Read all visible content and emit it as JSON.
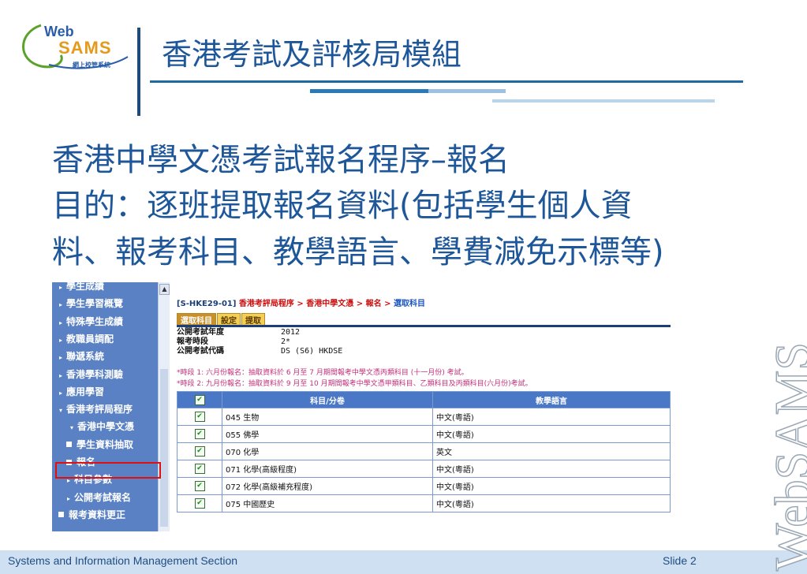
{
  "header": {
    "logo_web": "Web",
    "logo_sams": "SAMS",
    "logo_subtitle": "網上校管系統",
    "title": "香港考試及評核局模組"
  },
  "headings": {
    "line1": "香港中學文憑考試報名程序–報名",
    "line2": "目的：逐班提取報名資料(包括學生個人資",
    "line3": "料、報考科目、教學語言、學費減免示標等)"
  },
  "screenshot": {
    "sidebar": {
      "items": [
        {
          "label": "學生成績",
          "marker": "arrow"
        },
        {
          "label": "學生學習概覽",
          "marker": "arrow"
        },
        {
          "label": "特殊學生成績",
          "marker": "arrow"
        },
        {
          "label": "教職員調配",
          "marker": "arrow"
        },
        {
          "label": "聯遞系統",
          "marker": "arrow"
        },
        {
          "label": "香港學科測驗",
          "marker": "arrow"
        },
        {
          "label": "應用學習",
          "marker": "arrow"
        },
        {
          "label": "香港考評局程序",
          "marker": "expanded"
        },
        {
          "label": "香港中學文憑",
          "marker": "expanded"
        },
        {
          "label": "學生資料抽取",
          "marker": "bullet"
        },
        {
          "label": "報名",
          "marker": "bullet"
        },
        {
          "label": "科目參數",
          "marker": "arrow"
        },
        {
          "label": "公開考試報名",
          "marker": "arrow"
        },
        {
          "label": "報考資料更正",
          "marker": "bullet"
        }
      ],
      "scroll_up_icon": "▲"
    },
    "breadcrumb": {
      "code": "[S-HKE29-01]",
      "path": "香港考評局程序 > 香港中學文憑 > 報名 >",
      "current": "選取科目"
    },
    "tabs": [
      "選取科目",
      "設定",
      "提取"
    ],
    "info": [
      {
        "label": "公開考試年度",
        "value": "2012"
      },
      {
        "label": "報考時段",
        "value": "2*"
      },
      {
        "label": "公開考試代碼",
        "value": "DS (S6) HKDSE"
      }
    ],
    "notes": [
      "*時段 1: 六月份報名：抽取資料於 6 月至 7 月期間報考中學文憑丙類科目 (十一月份) 考試。",
      "*時段 2: 九月份報名：抽取資料於 9 月至 10 月期間報考中學文憑甲類科目、乙類科目及丙類科目(六月份)考試。"
    ],
    "table": {
      "headers": [
        "☑",
        "科目/分卷",
        "教學語言"
      ],
      "rows": [
        {
          "checked": "✔",
          "subject": "045 生物",
          "language": "中文(粵語)"
        },
        {
          "checked": "✔",
          "subject": "055 佛學",
          "language": "中文(粵語)"
        },
        {
          "checked": "✔",
          "subject": "070 化學",
          "language": "英文"
        },
        {
          "checked": "✔",
          "subject": "071 化學(高級程度)",
          "language": "中文(粵語)"
        },
        {
          "checked": "✔",
          "subject": "072 化學(高級補充程度)",
          "language": "中文(粵語)"
        },
        {
          "checked": "✔",
          "subject": "075 中國歷史",
          "language": "中文(粵語)"
        }
      ]
    }
  },
  "footer": {
    "left": "Systems and Information Management Section",
    "right": "Slide 2"
  },
  "watermark": "WebSAMS",
  "colors": {
    "title_blue": "#1e5799",
    "sidebar_blue": "#5a81c4",
    "highlight_red": "#e01010",
    "footer_bg": "#cfe0f3"
  }
}
